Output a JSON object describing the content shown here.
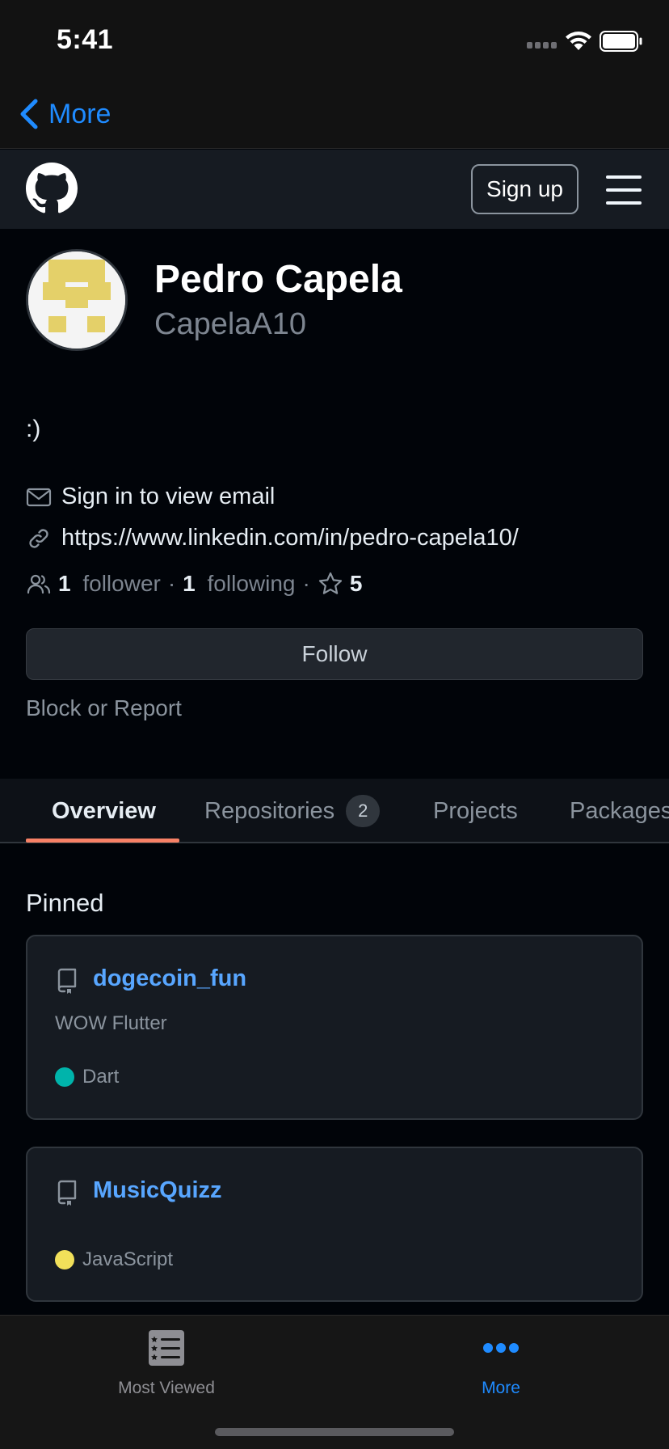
{
  "status_bar": {
    "time": "5:41"
  },
  "nav": {
    "back_label": "More"
  },
  "header": {
    "signup_label": "Sign up"
  },
  "profile": {
    "full_name": "Pedro Capela",
    "username": "CapelaA10",
    "bio": ":)",
    "email_text": "Sign in to view email",
    "link_text": "https://www.linkedin.com/in/pedro-capela10/",
    "followers_count": "1",
    "followers_label": "follower",
    "following_count": "1",
    "following_label": "following",
    "separator": "·",
    "stars_count": "5",
    "follow_label": "Follow",
    "block_label": "Block or Report"
  },
  "tabs": [
    {
      "label": "Overview",
      "active": true
    },
    {
      "label": "Repositories",
      "count": "2"
    },
    {
      "label": "Projects"
    },
    {
      "label": "Packages"
    }
  ],
  "pinned": {
    "title": "Pinned",
    "repos": [
      {
        "name": "dogecoin_fun",
        "description": "WOW Flutter",
        "language": "Dart",
        "language_color": "#00b4ab"
      },
      {
        "name": "MusicQuizz",
        "description": "",
        "language": "JavaScript",
        "language_color": "#f1e05a"
      }
    ]
  },
  "tab_bar": {
    "items": [
      {
        "label": "Most Viewed",
        "icon": "list-star-icon",
        "selected": false,
        "color": "#8e8e93"
      },
      {
        "label": "More",
        "icon": "more-dots-icon",
        "selected": true,
        "color": "#1f8bff"
      }
    ]
  },
  "colors": {
    "accent": "#1f8bff",
    "link": "#58a6ff",
    "tab_underline": "#f78166",
    "avatar_identicon": "#e4d069"
  }
}
